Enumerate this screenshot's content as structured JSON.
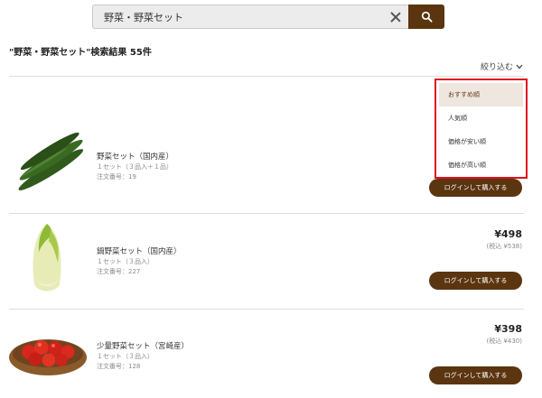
{
  "search": {
    "query": "野菜・野菜セット"
  },
  "results": {
    "title": "\"野菜・野菜セット\"検索結果 55件"
  },
  "filter": {
    "label": "絞り込む"
  },
  "sort": {
    "options": [
      "おすすめ順",
      "人気順",
      "価格が安い順",
      "価格が高い順"
    ],
    "selected": "おすすめ順"
  },
  "products": [
    {
      "name": "野菜セット（国内産）",
      "quantity": "１セット（３品入＋１品）",
      "order_number": "注文番号：19",
      "price": "",
      "tax_price": "",
      "button_label": "ログインして購入する"
    },
    {
      "name": "鍋野菜セット（国内産）",
      "quantity": "１セット（３品入）",
      "order_number": "注文番号：227",
      "price": "¥498",
      "tax_price": "(税込 ¥538)",
      "button_label": "ログインして購入する"
    },
    {
      "name": "少量野菜セット（宮崎産）",
      "quantity": "１セット（３品入）",
      "order_number": "注文番号：128",
      "price": "¥398",
      "tax_price": "(税込 ¥430)",
      "button_label": "ログインして購入する"
    }
  ],
  "colors": {
    "brand": "#5b3510",
    "highlight_border": "#e0121e",
    "selected_bg": "#efe7df"
  }
}
